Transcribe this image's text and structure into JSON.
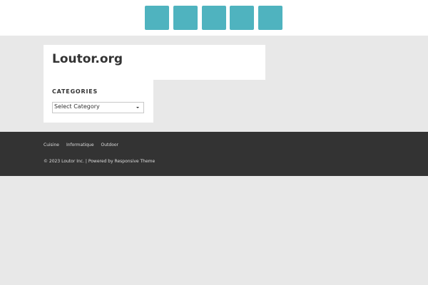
{
  "header": {
    "tile_color": "#4fb3bf",
    "tile_count": 5
  },
  "site": {
    "title": "Loutor.org"
  },
  "sidebar": {
    "widget_title": "CATEGORIES",
    "select_value": "Select Category"
  },
  "footer": {
    "links": [
      {
        "label": "Cuisine"
      },
      {
        "label": "Informatique"
      },
      {
        "label": "Outdoor"
      }
    ],
    "copyright": "© 2023 Loutor Inc.",
    "separator": "|",
    "powered_by": "Powered by Responsive Theme"
  }
}
